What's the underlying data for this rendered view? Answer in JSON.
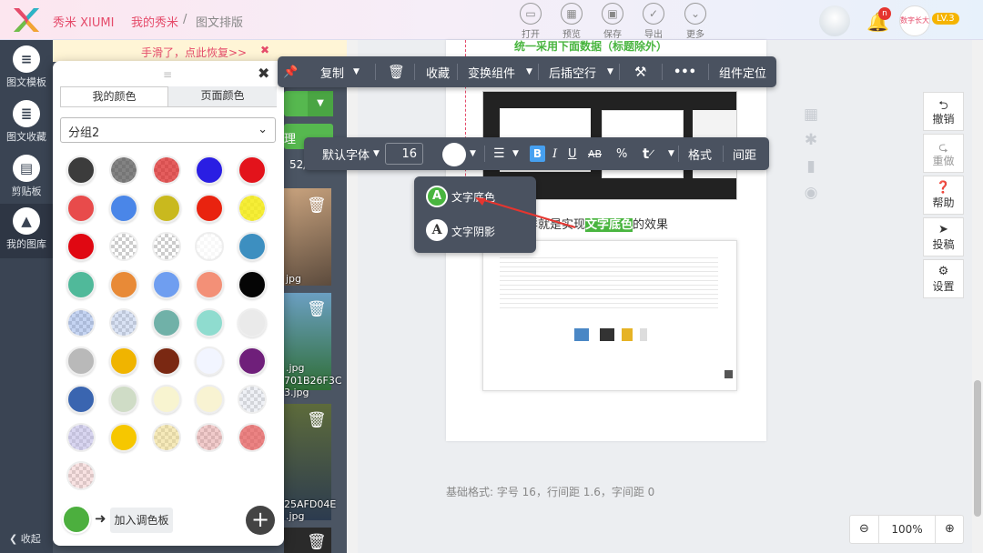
{
  "header": {
    "brand": "秀米 XIUMI",
    "crumb_mine": "我的秀米",
    "crumb_sep": "/",
    "crumb_current": "图文排版",
    "tools": [
      {
        "label": "打开",
        "icon": "folder-icon"
      },
      {
        "label": "预览",
        "icon": "preview-icon"
      },
      {
        "label": "保存",
        "icon": "save-icon"
      },
      {
        "label": "导出",
        "icon": "check-icon"
      },
      {
        "label": "更多",
        "icon": "chevron-down-icon"
      }
    ],
    "notification_count": "n",
    "avatar_text": "数字长大",
    "level": "LV.3"
  },
  "leftnav": {
    "items": [
      {
        "label": "图文模板"
      },
      {
        "label": "图文收藏"
      },
      {
        "label": "剪贴板"
      },
      {
        "label": "我的图库"
      }
    ],
    "collapse": "收起"
  },
  "library": {
    "restore_text": "手滑了，点此恢复>>",
    "count": "52/",
    "files": [
      "jpg",
      ".jpg",
      "701B26F3C",
      "3.jpg",
      "25AFD04E",
      ".jpg"
    ]
  },
  "picker": {
    "tabs": [
      "我的颜色",
      "页面颜色"
    ],
    "group": "分组2",
    "current_color": "#4caf3e",
    "add_label": "加入调色板",
    "swatches": [
      "#3c3c3c",
      "checker-gray",
      "checker-red",
      "#2a1ee3",
      "#e3131b",
      "#e84b4b",
      "#4a86e8",
      "#c9b91e",
      "#e9230f",
      "checker-yellow",
      "#e00812",
      "checker",
      "checker",
      "checker-white",
      "#3d8fc0",
      "#50b99a",
      "#e88a37",
      "#6f9ef0",
      "#f39077",
      "#050505",
      "checker-blue",
      "checker-lightblue",
      "#70b1a8",
      "#8fdccf",
      "#eaeaea",
      "#b9b9b9",
      "#f0b400",
      "#7a2812",
      "#f2f5ff",
      "#6f1f7a",
      "#3a65b0",
      "#cfdcc6",
      "#f8f4d0",
      "#f8f3d2",
      "checker-light",
      "checker-lavender",
      "#f6c700",
      "checker-beige",
      "checker-pink",
      "checker-coral",
      "checker-rose"
    ]
  },
  "component_toolbar": {
    "copy": "复制",
    "collect": "收藏",
    "transform": "变换组件",
    "insert": "后插空行",
    "more": "•••",
    "locate": "组件定位"
  },
  "text_toolbar": {
    "font": "默认字体",
    "size": "16",
    "format": "格式",
    "spacing": "间距",
    "b": "B",
    "i": "I",
    "u": "U",
    "ab": "AB"
  },
  "text_menu": {
    "items": [
      "文字底色",
      "文字阴影"
    ]
  },
  "canvas": {
    "heading": "统一采用下面数据（标题除外）",
    "line_pre": "这样就是实现",
    "line_highlight": "文字底色",
    "line_post": "的效果",
    "status": "基础格式: 字号 16，行间距 1.6，字间距 0",
    "zoom": "100%"
  },
  "right_actions": [
    {
      "label": "撤销"
    },
    {
      "label": "重做"
    },
    {
      "label": "帮助"
    },
    {
      "label": "投稿"
    },
    {
      "label": "设置"
    }
  ],
  "colors": {
    "brand_pink": "#e54b6a",
    "toolbar": "#4a5260",
    "highlight_green": "#49b53f"
  }
}
